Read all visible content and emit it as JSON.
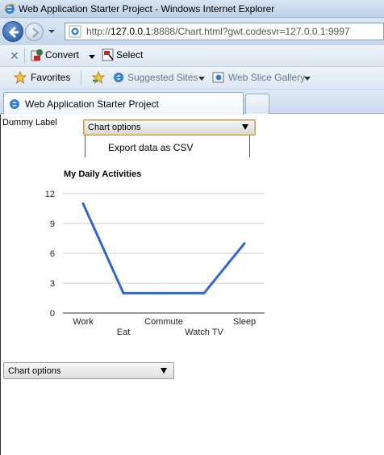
{
  "window": {
    "title": "Web Application Starter Project - Windows Internet Explorer"
  },
  "address": {
    "url_prefix": "http://",
    "url_host": "127.0.0.1",
    "url_rest": ":8888/Chart.html?gwt.codesvr=127.0.0.1:9997"
  },
  "command_bar": {
    "convert_label": "Convert",
    "select_label": "Select"
  },
  "favorites_bar": {
    "favorites_label": "Favorites",
    "suggested_sites_label": "Suggested Sites",
    "web_slice_label": "Web Slice Gallery"
  },
  "tab": {
    "title": "Web Application Starter Project"
  },
  "page": {
    "dummy_label": "Dummy Label",
    "top_select_value": "Chart options",
    "menu_item": "Export data as CSV",
    "bottom_select_value": "Chart options"
  },
  "chart_data": {
    "type": "line",
    "title": "My Daily Activities",
    "categories": [
      "Work",
      "Eat",
      "Commute",
      "Watch TV",
      "Sleep"
    ],
    "values": [
      11,
      2,
      2,
      2,
      7
    ],
    "ylim": [
      0,
      12
    ],
    "yticks": [
      0,
      3,
      6,
      9,
      12
    ],
    "grid": true,
    "line_color": "#3366cc",
    "xlabel": "",
    "ylabel": ""
  }
}
